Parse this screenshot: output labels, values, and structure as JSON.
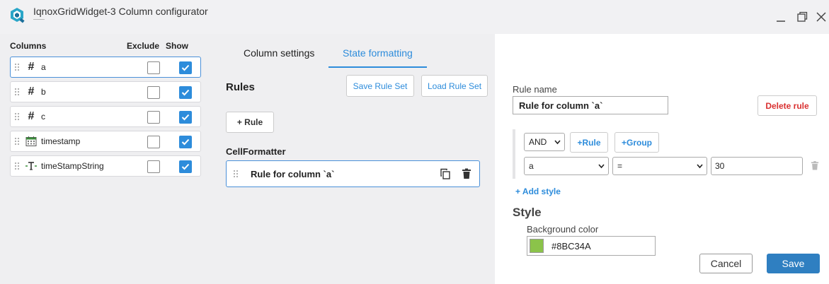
{
  "window": {
    "title": "IqnoxGridWidget-3 Column configurator"
  },
  "columns_panel": {
    "headers": {
      "columns": "Columns",
      "exclude": "Exclude",
      "show": "Show"
    },
    "items": [
      {
        "name": "a",
        "type_icon": "hash-icon",
        "exclude": false,
        "show": true,
        "active": true
      },
      {
        "name": "b",
        "type_icon": "hash-icon",
        "exclude": false,
        "show": true,
        "active": false
      },
      {
        "name": "c",
        "type_icon": "hash-icon",
        "exclude": false,
        "show": true,
        "active": false
      },
      {
        "name": "timestamp",
        "type_icon": "calendar-icon",
        "exclude": false,
        "show": true,
        "active": false
      },
      {
        "name": "timeStampString",
        "type_icon": "text-type-icon",
        "exclude": false,
        "show": true,
        "active": false
      }
    ]
  },
  "tabs": [
    {
      "label": "Column settings",
      "active": false
    },
    {
      "label": "State formatting",
      "active": true
    }
  ],
  "rules_panel": {
    "title": "Rules",
    "save_rule_set": "Save Rule Set",
    "load_rule_set": "Load Rule Set",
    "add_rule": "+ Rule",
    "formatter_title": "CellFormatter",
    "rule_items": [
      {
        "label": "Rule for column `a`"
      }
    ]
  },
  "rule_editor": {
    "name_label": "Rule name",
    "name_value": "Rule for column `a`",
    "delete_rule": "Delete rule",
    "group_operator": "AND",
    "add_rule": "+Rule",
    "add_group": "+Group",
    "condition": {
      "field": "a",
      "operator": "=",
      "value": "30"
    },
    "add_style": "+ Add style",
    "style_title": "Style",
    "background_label": "Background color",
    "background_value": "#8BC34A",
    "cancel": "Cancel",
    "save": "Save"
  },
  "colors": {
    "accent": "#2d8cdb",
    "swatch": "#8BC34A",
    "danger": "#d93030"
  }
}
